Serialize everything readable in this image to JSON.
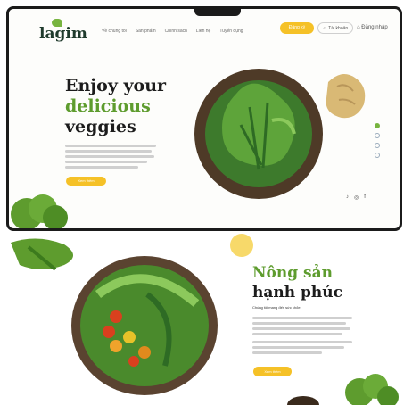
{
  "logo": {
    "text": "lagim"
  },
  "nav": {
    "items": [
      "Về chúng tôi",
      "Sản phẩm",
      "Chính sách",
      "Liên hệ",
      "Tuyển dụng"
    ]
  },
  "header": {
    "cta_label": "Đăng ký",
    "account_label": "Tài khoản",
    "login_label": "Đăng nhập"
  },
  "hero": {
    "line1": "Enjoy your",
    "line2": "delicious",
    "line3": "veggies",
    "button_label": "Xem thêm"
  },
  "section2": {
    "line1": "Nông sản",
    "line2": "hạnh phúc",
    "subtitle": "Chúng tôi mang đến sức khỏe",
    "button_label": "Xem thêm"
  },
  "social": [
    "♪",
    "◎",
    "f"
  ],
  "colors": {
    "accent": "#f5c127",
    "brand_green": "#5e9c2e"
  }
}
